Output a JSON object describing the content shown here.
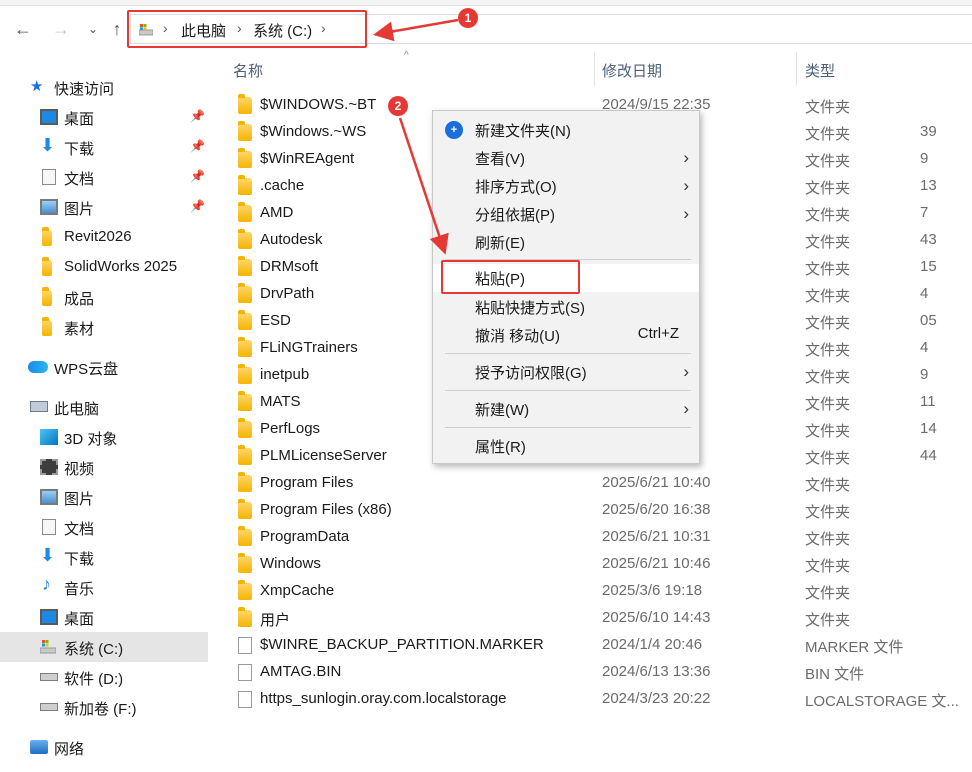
{
  "address_bar": {
    "crumbs": [
      "此电脑",
      "系统 (C:)"
    ]
  },
  "annotations": {
    "badge1": "1",
    "badge2": "2"
  },
  "columns": {
    "name": "名称",
    "date": "修改日期",
    "type": "类型"
  },
  "sidebar": {
    "quick_access": "快速访问",
    "quick_items": [
      "桌面",
      "下载",
      "文档",
      "图片",
      "Revit2026",
      "SolidWorks 2025",
      "成品",
      "素材"
    ],
    "wps": "WPS云盘",
    "this_pc": "此电脑",
    "pc_items": [
      "3D 对象",
      "视频",
      "图片",
      "文档",
      "下载",
      "音乐",
      "桌面",
      "系统 (C:)",
      "软件 (D:)",
      "新加卷 (F:)"
    ],
    "network": "网络"
  },
  "files": [
    {
      "name": "$WINDOWS.~BT",
      "date": "2024/9/15 22:35",
      "type": "文件夹",
      "icon": "folder"
    },
    {
      "name": "$Windows.~WS",
      "date": "39",
      "type": "文件夹",
      "icon": "folder"
    },
    {
      "name": "$WinREAgent",
      "date": "9",
      "type": "文件夹",
      "icon": "folder"
    },
    {
      "name": ".cache",
      "date": "13",
      "type": "文件夹",
      "icon": "folder"
    },
    {
      "name": "AMD",
      "date": "7",
      "type": "文件夹",
      "icon": "folder"
    },
    {
      "name": "Autodesk",
      "date": "43",
      "type": "文件夹",
      "icon": "folder"
    },
    {
      "name": "DRMsoft",
      "date": "15",
      "type": "文件夹",
      "icon": "folder"
    },
    {
      "name": "DrvPath",
      "date": "4",
      "type": "文件夹",
      "icon": "folder"
    },
    {
      "name": "ESD",
      "date": "05",
      "type": "文件夹",
      "icon": "folder"
    },
    {
      "name": "FLiNGTrainers",
      "date": "4",
      "type": "文件夹",
      "icon": "folder"
    },
    {
      "name": "inetpub",
      "date": "9",
      "type": "文件夹",
      "icon": "folder"
    },
    {
      "name": "MATS",
      "date": "11",
      "type": "文件夹",
      "icon": "folder"
    },
    {
      "name": "PerfLogs",
      "date": "14",
      "type": "文件夹",
      "icon": "folder"
    },
    {
      "name": "PLMLicenseServer",
      "date": "44",
      "type": "文件夹",
      "icon": "folder"
    },
    {
      "name": "Program Files",
      "date": "2025/6/21 10:40",
      "type": "文件夹",
      "icon": "folder"
    },
    {
      "name": "Program Files (x86)",
      "date": "2025/6/20 16:38",
      "type": "文件夹",
      "icon": "folder"
    },
    {
      "name": "ProgramData",
      "date": "2025/6/21 10:31",
      "type": "文件夹",
      "icon": "folder"
    },
    {
      "name": "Windows",
      "date": "2025/6/21 10:46",
      "type": "文件夹",
      "icon": "folder"
    },
    {
      "name": "XmpCache",
      "date": "2025/3/6 19:18",
      "type": "文件夹",
      "icon": "folder"
    },
    {
      "name": "用户",
      "date": "2025/6/10 14:43",
      "type": "文件夹",
      "icon": "folder"
    },
    {
      "name": "$WINRE_BACKUP_PARTITION.MARKER",
      "date": "2024/1/4 20:46",
      "type": "MARKER 文件",
      "icon": "file"
    },
    {
      "name": "AMTAG.BIN",
      "date": "2024/6/13 13:36",
      "type": "BIN 文件",
      "icon": "file"
    },
    {
      "name": "https_sunlogin.oray.com.localstorage",
      "date": "2024/3/23 20:22",
      "type": "LOCALSTORAGE 文...",
      "icon": "file"
    }
  ],
  "context_menu": {
    "new_folder": "新建文件夹(N)",
    "view": "查看(V)",
    "sort": "排序方式(O)",
    "group": "分组依据(P)",
    "refresh": "刷新(E)",
    "paste": "粘贴(P)",
    "paste_shortcut": "粘贴快捷方式(S)",
    "undo": "撤消 移动(U)",
    "undo_shortcut": "Ctrl+Z",
    "grant": "授予访问权限(G)",
    "new": "新建(W)",
    "properties": "属性(R)"
  },
  "colors": {
    "highlight_red": "#e53935",
    "folder": "#f4b400",
    "accent_blue": "#1a6fdc"
  }
}
